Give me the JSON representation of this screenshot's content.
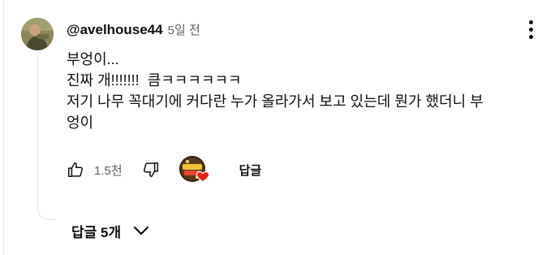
{
  "comment": {
    "username": "@avelhouse44",
    "time": "5일 전",
    "lines": [
      "부엉이...",
      "진짜 개!!!!!!!  큼ㅋㅋㅋㅋㅋㅋ",
      "저기 나무 꼭대기에 커다란 누가 올라가서 보고 있는데 뭔가 했더니 부",
      "엉이"
    ],
    "like_count": "1.5천",
    "reply_label": "답글",
    "replies_label": "답글 5개"
  },
  "icons": {
    "menu": "more-vertical-icon",
    "like": "thumbs-up-icon",
    "dislike": "thumbs-down-icon",
    "heart": "creator-heart-icon",
    "expand": "chevron-down-icon"
  },
  "colors": {
    "text": "#0f0f0f",
    "secondary": "#606060",
    "heart": "#e62117"
  }
}
